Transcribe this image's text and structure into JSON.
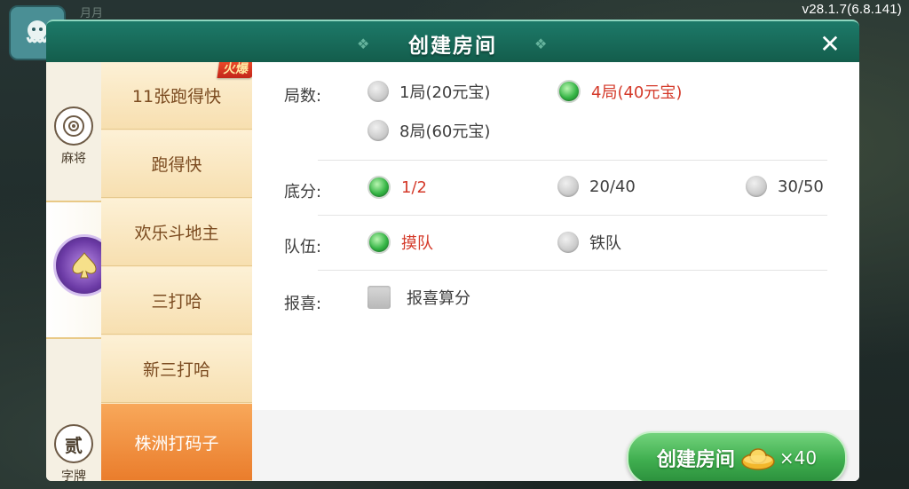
{
  "version": "v28.1.7(6.8.141)",
  "background": {
    "player_name": "月月"
  },
  "dialog": {
    "title": "创建房间",
    "close_label": "✕"
  },
  "categories": [
    {
      "label": "麻将",
      "icon": "mahjong-icon"
    },
    {
      "label": "",
      "icon": "spade-poker-icon",
      "active": true
    },
    {
      "label": "字牌",
      "icon": "zipai-icon",
      "icon_glyph": "贰"
    }
  ],
  "games": [
    {
      "label": "11张跑得快",
      "badge": "火爆"
    },
    {
      "label": "跑得快"
    },
    {
      "label": "欢乐斗地主"
    },
    {
      "label": "三打哈"
    },
    {
      "label": "新三打哈"
    },
    {
      "label": "株洲打码子",
      "selected": true
    }
  ],
  "options": {
    "rounds": {
      "label": "局数:",
      "choices": [
        {
          "label": "1局(20元宝)",
          "selected": false
        },
        {
          "label": "4局(40元宝)",
          "selected": true
        },
        {
          "label": "8局(60元宝)",
          "selected": false
        }
      ]
    },
    "base_score": {
      "label": "底分:",
      "choices": [
        {
          "label": "1/2",
          "selected": true
        },
        {
          "label": "20/40",
          "selected": false
        },
        {
          "label": "30/50",
          "selected": false
        }
      ]
    },
    "team": {
      "label": "队伍:",
      "choices": [
        {
          "label": "摸队",
          "selected": true
        },
        {
          "label": "铁队",
          "selected": false
        }
      ]
    },
    "bonus": {
      "label": "报喜:",
      "checkbox_label": "报喜算分",
      "checked": false
    }
  },
  "create_button": {
    "label": "创建房间",
    "cost": "×40",
    "icon": "gold-ingot-icon"
  },
  "colors": {
    "header": "#1d7a69",
    "selected_text": "#d43a2a",
    "button_green": "#3fae4f",
    "selected_game": "#ea7d2c"
  }
}
